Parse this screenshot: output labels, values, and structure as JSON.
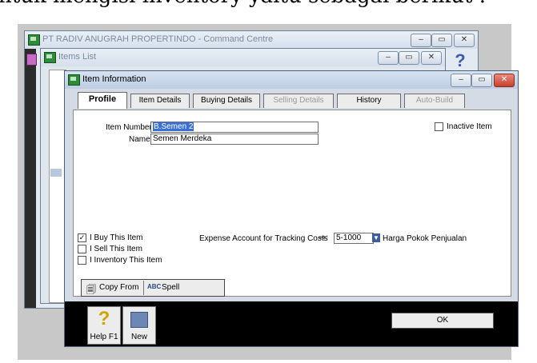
{
  "caption": "ntuk mengisi inventory yaitu sebagai berikut :",
  "command_centre": {
    "title": "PT RADIV ANUGRAH PROPERTINDO - Command Centre"
  },
  "items_list": {
    "title": "Items List"
  },
  "item_info": {
    "title": "Item Information",
    "tabs": [
      {
        "label": "Profile"
      },
      {
        "label": "Item Details"
      },
      {
        "label": "Buying Details"
      },
      {
        "label": "Selling Details"
      },
      {
        "label": "History"
      },
      {
        "label": "Auto-Build"
      }
    ],
    "item_number_label": "Item Number:",
    "item_number_value": "B.Semen 2",
    "name_label": "Name:",
    "name_value": "Semen Merdeka",
    "inactive_label": "Inactive Item",
    "buy_label": "I Buy This Item",
    "sell_label": "I Sell This Item",
    "inventory_label": "I Inventory This Item",
    "expense_label": "Expense Account for Tracking Costs",
    "expense_account": "5-1000",
    "expense_account_name": "Harga Pokok Penjualan",
    "copy_from": "Copy From",
    "spell": "Spell",
    "help_label": "Help F1",
    "new_label": "New",
    "ok_label": "OK"
  }
}
